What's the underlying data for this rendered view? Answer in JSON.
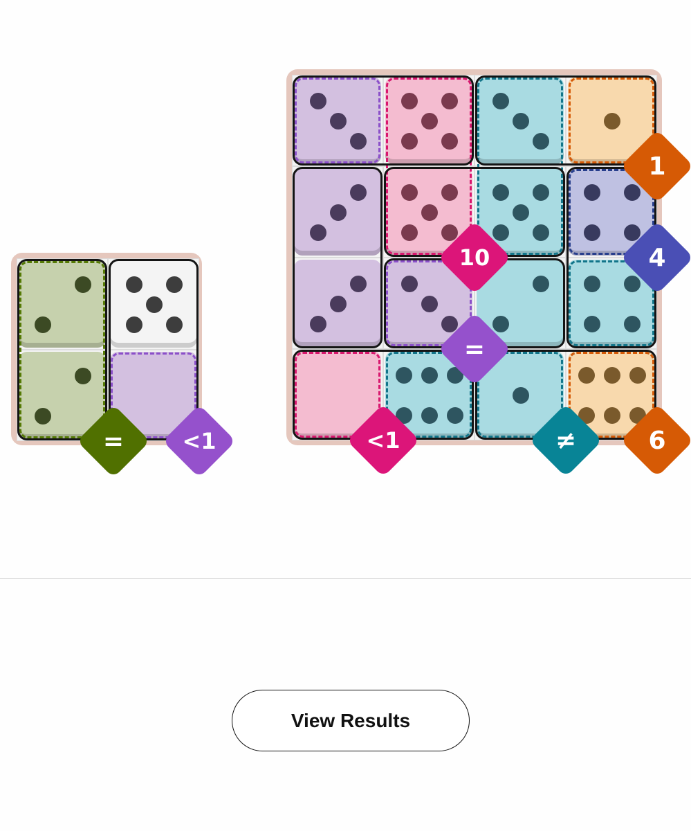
{
  "colors": {
    "board": "#e5c7bd",
    "cell_empty": "#f4f4f4",
    "domino_border": "#141414",
    "regions": {
      "olive": {
        "fill": "#c6d1ad",
        "pip": "#3c4a24",
        "dash": "#557a05"
      },
      "purple": {
        "fill": "#d3c0e0",
        "pip": "#4a3b5c",
        "dash": "#8b50c9"
      },
      "pink": {
        "fill": "#f4bcd0",
        "pip": "#7a3a4e",
        "dash": "#d8176e"
      },
      "teal": {
        "fill": "#a9dbe2",
        "pip": "#2e5560",
        "dash": "#12758a"
      },
      "orange": {
        "fill": "#f8d9ad",
        "pip": "#7a5a2c",
        "dash": "#d55a07"
      },
      "indigo": {
        "fill": "#bfc1e2",
        "pip": "#383a5e",
        "dash": "#273e8c"
      },
      "white": {
        "fill": "#f4f4f4",
        "pip": "#3d3d3d",
        "dash": "#ffffff"
      }
    },
    "badges": {
      "olive": "#507000",
      "purple": "#9551cc",
      "pink": "#dc1579",
      "teal": "#088496",
      "orange": "#d65a05",
      "indigo": "#4a4fb5"
    }
  },
  "boards": [
    {
      "id": "left",
      "cols": 2,
      "rows": 2,
      "cells": [
        {
          "r": 0,
          "c": 0,
          "value": 2,
          "region": "olive"
        },
        {
          "r": 0,
          "c": 1,
          "value": 5,
          "region": "white"
        },
        {
          "r": 1,
          "c": 0,
          "value": 2,
          "region": "olive"
        },
        {
          "r": 1,
          "c": 1,
          "value": 0,
          "region": "purple"
        }
      ],
      "regions": [
        {
          "name": "olive",
          "cells": [
            [
              0,
              0
            ],
            [
              1,
              0
            ]
          ]
        },
        {
          "name": "purple",
          "cells": [
            [
              1,
              1
            ]
          ]
        }
      ],
      "dominoes": [
        [
          [
            0,
            0
          ],
          [
            1,
            0
          ]
        ],
        [
          [
            0,
            1
          ],
          [
            1,
            1
          ]
        ]
      ],
      "badges": [
        {
          "text": "=",
          "color": "olive",
          "r": 1,
          "c": 0
        },
        {
          "text": "<1",
          "color": "purple",
          "r": 1,
          "c": 1
        }
      ]
    },
    {
      "id": "right",
      "cols": 4,
      "rows": 4,
      "cells": [
        {
          "r": 0,
          "c": 0,
          "value": 3,
          "region": "purple"
        },
        {
          "r": 0,
          "c": 1,
          "value": 5,
          "region": "pink"
        },
        {
          "r": 0,
          "c": 2,
          "value": 3,
          "region": "teal"
        },
        {
          "r": 0,
          "c": 3,
          "value": 1,
          "region": "orange"
        },
        {
          "r": 1,
          "c": 0,
          "value": 3,
          "region": "purple"
        },
        {
          "r": 1,
          "c": 1,
          "value": 5,
          "region": "pink"
        },
        {
          "r": 1,
          "c": 2,
          "value": 5,
          "region": "teal"
        },
        {
          "r": 1,
          "c": 3,
          "value": 4,
          "region": "indigo"
        },
        {
          "r": 2,
          "c": 0,
          "value": 3,
          "region": "purple"
        },
        {
          "r": 2,
          "c": 1,
          "value": 3,
          "region": "purple"
        },
        {
          "r": 2,
          "c": 2,
          "value": 2,
          "region": "teal"
        },
        {
          "r": 2,
          "c": 3,
          "value": 4,
          "region": "teal"
        },
        {
          "r": 3,
          "c": 0,
          "value": 0,
          "region": "pink"
        },
        {
          "r": 3,
          "c": 1,
          "value": 6,
          "region": "teal"
        },
        {
          "r": 3,
          "c": 2,
          "value": 1,
          "region": "teal"
        },
        {
          "r": 3,
          "c": 3,
          "value": 6,
          "region": "orange"
        }
      ],
      "regions": [
        {
          "name": "purple",
          "cells": [
            [
              0,
              0
            ]
          ]
        },
        {
          "name": "pink",
          "cells": [
            [
              0,
              1
            ],
            [
              1,
              1
            ]
          ]
        },
        {
          "name": "teal",
          "cells": [
            [
              0,
              2
            ],
            [
              1,
              2
            ]
          ]
        },
        {
          "name": "orange",
          "cells": [
            [
              0,
              3
            ]
          ]
        },
        {
          "name": "indigo",
          "cells": [
            [
              1,
              3
            ]
          ]
        },
        {
          "name": "purple",
          "cells": [
            [
              2,
              1
            ]
          ]
        },
        {
          "name": "pink",
          "cells": [
            [
              3,
              0
            ]
          ]
        },
        {
          "name": "teal",
          "cells": [
            [
              2,
              3
            ],
            [
              3,
              1
            ],
            [
              3,
              2
            ],
            [
              3,
              3
            ]
          ]
        },
        {
          "name": "orange",
          "cells": [
            [
              3,
              3
            ]
          ]
        }
      ],
      "dominoes": [
        [
          [
            0,
            0
          ],
          [
            0,
            1
          ]
        ],
        [
          [
            0,
            2
          ],
          [
            0,
            3
          ]
        ],
        [
          [
            1,
            0
          ],
          [
            2,
            0
          ]
        ],
        [
          [
            1,
            1
          ],
          [
            1,
            2
          ]
        ],
        [
          [
            1,
            3
          ],
          [
            2,
            3
          ]
        ],
        [
          [
            2,
            1
          ],
          [
            2,
            2
          ]
        ],
        [
          [
            3,
            0
          ],
          [
            3,
            1
          ]
        ],
        [
          [
            3,
            2
          ],
          [
            3,
            3
          ]
        ]
      ],
      "badges": [
        {
          "text": "1",
          "color": "orange",
          "r": 0,
          "c": 3
        },
        {
          "text": "10",
          "color": "pink",
          "r": 1,
          "c": 1
        },
        {
          "text": "4",
          "color": "indigo",
          "r": 1,
          "c": 3
        },
        {
          "text": "=",
          "color": "purple",
          "r": 2,
          "c": 1
        },
        {
          "text": "<1",
          "color": "pink",
          "r": 3,
          "c": 0
        },
        {
          "text": "≠",
          "color": "teal",
          "r": 3,
          "c": 2
        },
        {
          "text": "6",
          "color": "orange",
          "r": 3,
          "c": 3
        }
      ]
    }
  ],
  "footer": {
    "view_results_label": "View Results"
  }
}
